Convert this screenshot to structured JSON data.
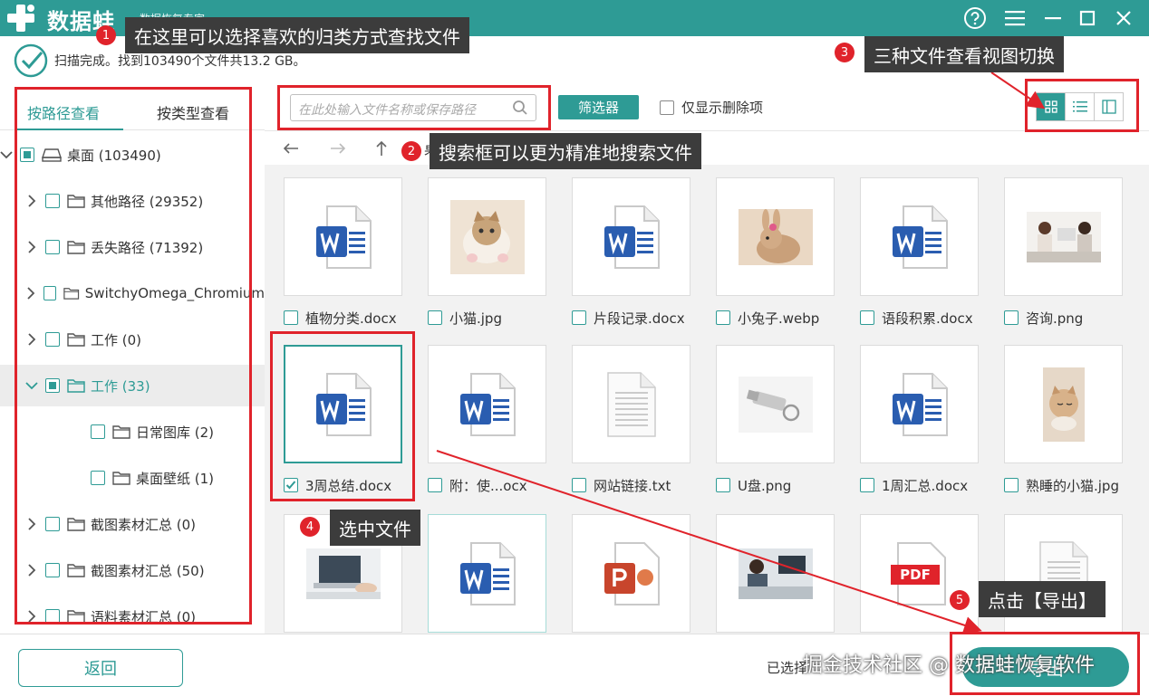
{
  "app": {
    "brand": "数据蛙",
    "subtitle": "数据恢复专家",
    "colors": {
      "accent": "#2e9b95",
      "annotation": "#e0232b"
    }
  },
  "status": {
    "text": "扫描完成。找到103490个文件共13.2 GB。"
  },
  "left_tabs": {
    "path": "按路径查看",
    "type": "按类型查看"
  },
  "tree": [
    {
      "label": "桌面 (103490)",
      "state": "partial",
      "icon": "drive-icon"
    },
    {
      "label": "其他路径 (29352)",
      "state": "unchecked",
      "icon": "folder-icon"
    },
    {
      "label": "丢失路径 (71392)",
      "state": "unchecked",
      "icon": "folder-icon"
    },
    {
      "label": "SwitchyOmega_Chromium",
      "state": "unchecked",
      "icon": "folder-icon"
    },
    {
      "label": "工作 (0)",
      "state": "unchecked",
      "icon": "folder-icon"
    },
    {
      "label": "工作 (33)",
      "state": "partial",
      "icon": "folder-icon",
      "expanded": true,
      "selected": true
    },
    {
      "label": "日常图库 (2)",
      "state": "unchecked",
      "icon": "folder-icon"
    },
    {
      "label": "桌面壁纸 (1)",
      "state": "unchecked",
      "icon": "folder-icon"
    },
    {
      "label": "截图素材汇总 (0)",
      "state": "unchecked",
      "icon": "folder-icon"
    },
    {
      "label": "截图素材汇总 (50)",
      "state": "unchecked",
      "icon": "folder-icon"
    },
    {
      "label": "语料素材汇总 (0)",
      "state": "unchecked",
      "icon": "folder-icon"
    }
  ],
  "toolbar": {
    "search_placeholder": "在此处输入文件名称或保存路径",
    "filter_label": "筛选器",
    "deleted_only_label": "仅显示删除项"
  },
  "nav": {
    "path_text": "桌"
  },
  "files": [
    {
      "name": "植物分类.docx",
      "kind": "word",
      "checked": false
    },
    {
      "name": "小猫.jpg",
      "kind": "photo-cat",
      "checked": false
    },
    {
      "name": "片段记录.docx",
      "kind": "word",
      "checked": false
    },
    {
      "name": "小兔子.webp",
      "kind": "photo-rabbit",
      "checked": false
    },
    {
      "name": "语段积累.docx",
      "kind": "word",
      "checked": false
    },
    {
      "name": "咨询.png",
      "kind": "photo-office",
      "checked": false
    },
    {
      "name": "3周总结.docx",
      "kind": "word",
      "checked": true
    },
    {
      "name": "附：使...ocx",
      "kind": "word",
      "checked": false
    },
    {
      "name": "网站链接.txt",
      "kind": "text",
      "checked": false
    },
    {
      "name": "U盘.png",
      "kind": "photo-usb",
      "checked": false
    },
    {
      "name": "1周汇总.docx",
      "kind": "word",
      "checked": false
    },
    {
      "name": "熟睡的小猫.jpg",
      "kind": "photo-kitten",
      "checked": false
    },
    {
      "name": "",
      "kind": "photo-laptop",
      "checked": false
    },
    {
      "name": "",
      "kind": "word",
      "checked": false
    },
    {
      "name": "",
      "kind": "ppt",
      "checked": false
    },
    {
      "name": "",
      "kind": "photo-desk",
      "checked": false
    },
    {
      "name": "",
      "kind": "pdf",
      "checked": false
    },
    {
      "name": "",
      "kind": "text",
      "checked": false
    }
  ],
  "footer": {
    "back_label": "返回",
    "selected_info": "已选择",
    "export_label": "导出",
    "watermark": "掘金技术社区 @ 数据蛙恢复软件"
  },
  "annotations": [
    {
      "n": "1",
      "text": "在这里可以选择喜欢的归类方式查找文件"
    },
    {
      "n": "2",
      "text": "搜索框可以更为精准地搜索文件"
    },
    {
      "n": "3",
      "text": "三种文件查看视图切换"
    },
    {
      "n": "4",
      "text": "选中文件"
    },
    {
      "n": "5",
      "text": "点击【导出】"
    }
  ]
}
